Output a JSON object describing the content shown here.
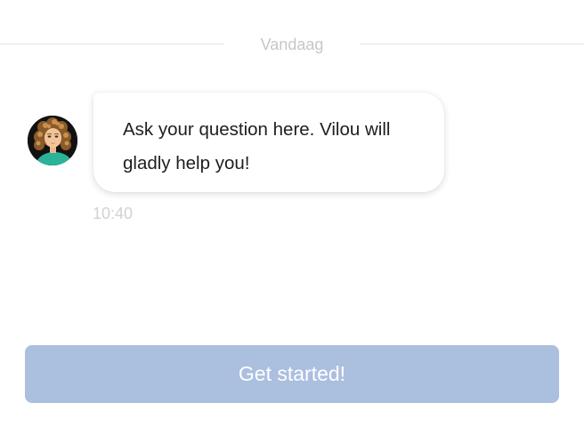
{
  "divider": {
    "label": "Vandaag"
  },
  "message": {
    "sender_avatar": "avatar-vilou",
    "text": "Ask your question here. Vilou will gladly help you!",
    "time": "10:40"
  },
  "cta": {
    "label": "Get started!"
  },
  "colors": {
    "button_bg": "#abbfdf",
    "button_text": "#ffffff",
    "divider_line": "#e3e3e3",
    "muted_text": "#c7c7c7",
    "bubble_text": "#1e1e1e"
  }
}
